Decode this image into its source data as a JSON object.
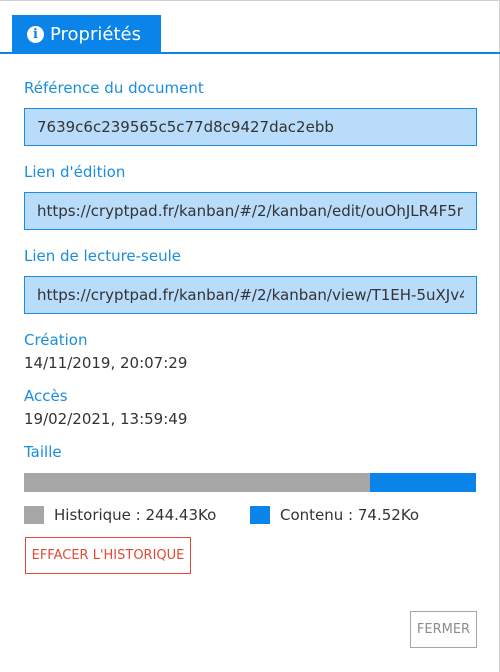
{
  "tab": {
    "icon": "info-circle-icon",
    "label": "Propriétés"
  },
  "document_reference": {
    "label": "Référence du document",
    "value": "7639c6c239565c5c77d8c9427dac2ebb"
  },
  "edit_link": {
    "label": "Lien d'édition",
    "value": "https://cryptpad.fr/kanban/#/2/kanban/edit/ouOhJLR4F5r"
  },
  "readonly_link": {
    "label": "Lien de lecture-seule",
    "value": "https://cryptpad.fr/kanban/#/2/kanban/view/T1EH-5uXJv4"
  },
  "creation": {
    "label": "Création",
    "value": "14/11/2019, 20:07:29"
  },
  "access": {
    "label": "Accès",
    "value": "19/02/2021, 13:59:49"
  },
  "size": {
    "label": "Taille",
    "history": {
      "label": "Historique : 244.43Ko",
      "kilobytes": 244.43,
      "color": "#a6a6a6"
    },
    "content": {
      "label": "Contenu : 74.52Ko",
      "kilobytes": 74.52,
      "color": "#0a84e8"
    }
  },
  "buttons": {
    "clear_history": "EFFACER L'HISTORIQUE",
    "close": "FERMER"
  },
  "colors": {
    "accent": "#0a84e8",
    "danger": "#e04b36",
    "field_bg": "#b9dcfb"
  }
}
